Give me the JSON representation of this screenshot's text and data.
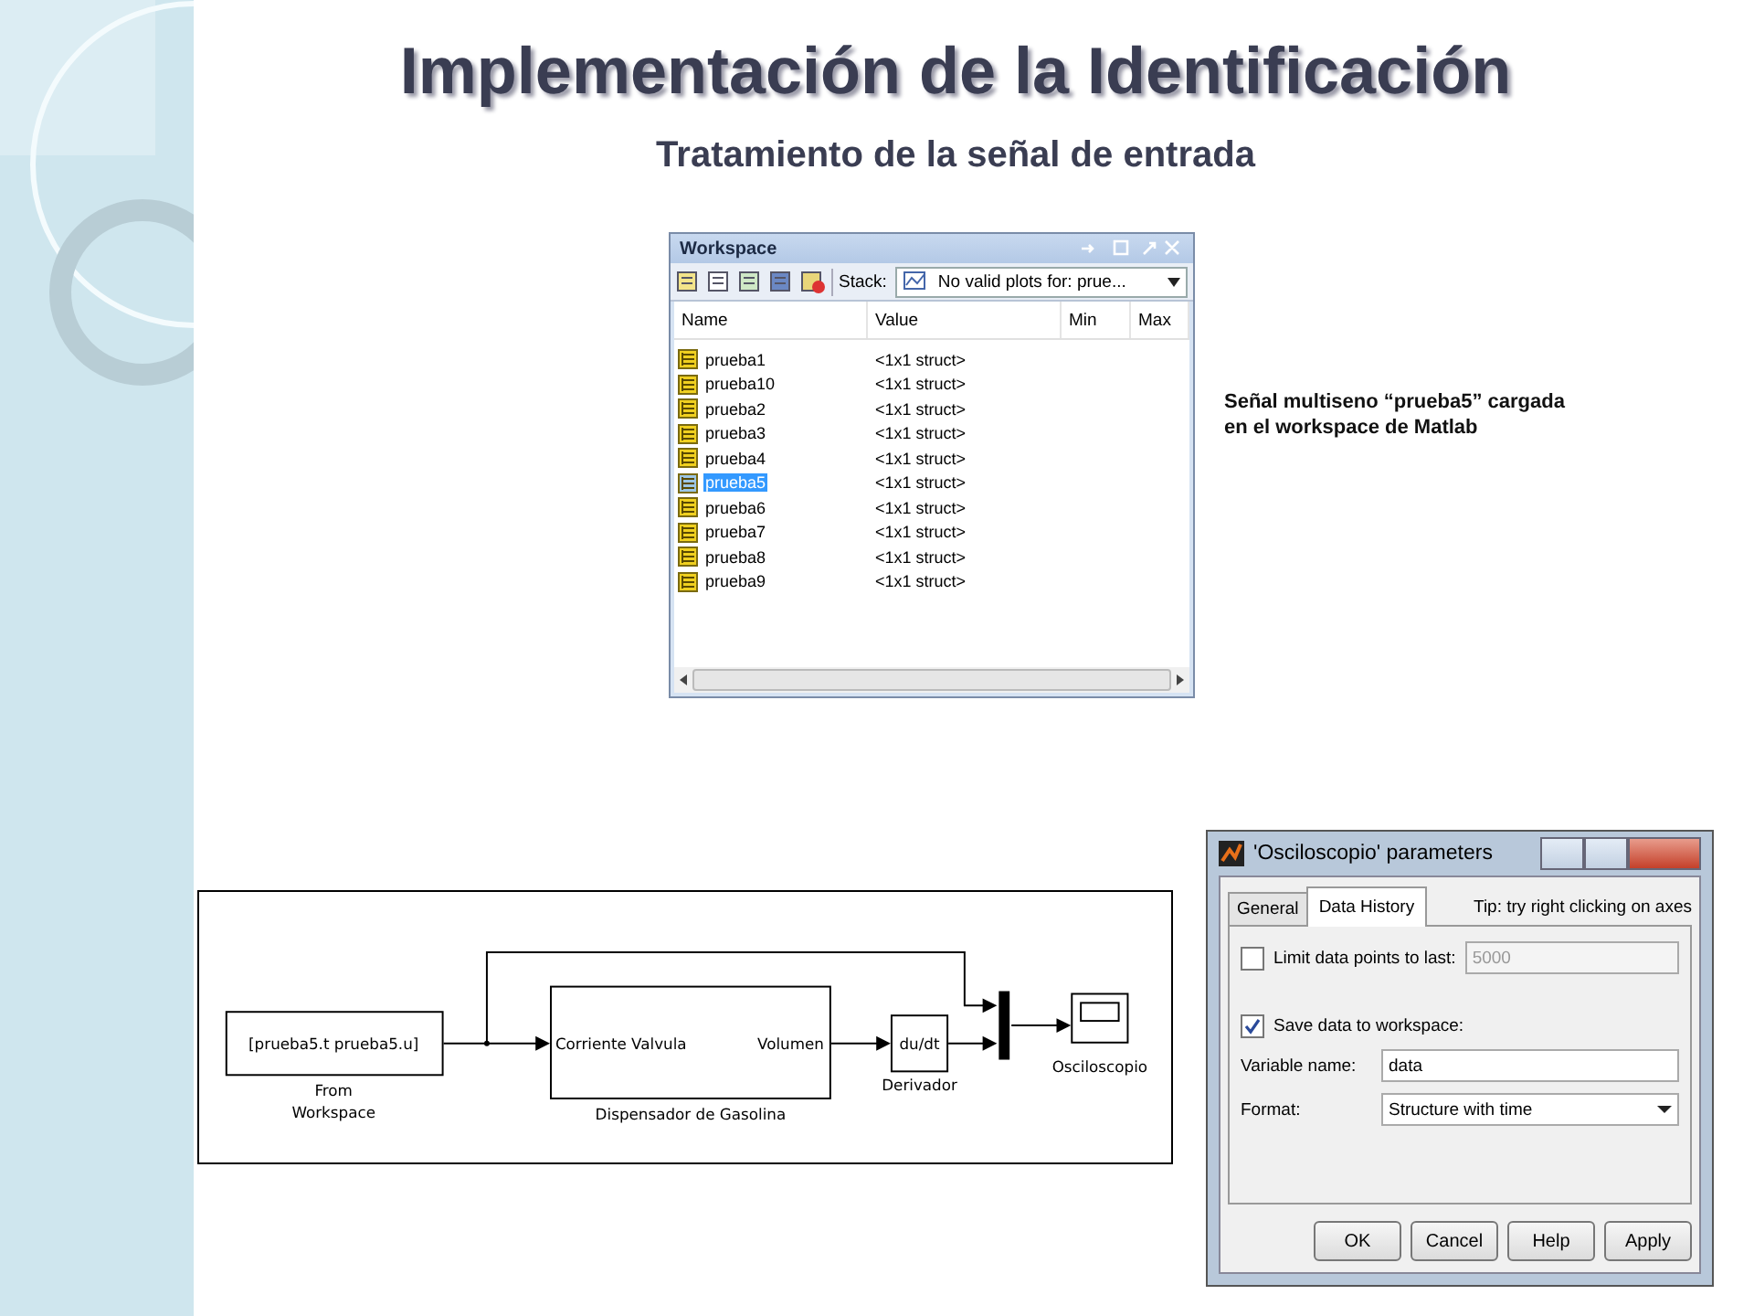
{
  "slide": {
    "title": "Implementación de la Identificación",
    "subtitle": "Tratamiento de la señal de entrada",
    "caption_lines": [
      "Señal multiseno “prueba5” cargada",
      "en el workspace de Matlab"
    ]
  },
  "workspace": {
    "title": "Workspace",
    "stack_label": "Stack:",
    "plots_dropdown": "No valid plots for: prue...",
    "columns": [
      "Name",
      "Value",
      "Min",
      "Max"
    ],
    "rows": [
      {
        "name": "prueba1",
        "value": "<1x1 struct>",
        "selected": false
      },
      {
        "name": "prueba10",
        "value": "<1x1 struct>",
        "selected": false
      },
      {
        "name": "prueba2",
        "value": "<1x1 struct>",
        "selected": false
      },
      {
        "name": "prueba3",
        "value": "<1x1 struct>",
        "selected": false
      },
      {
        "name": "prueba4",
        "value": "<1x1 struct>",
        "selected": false
      },
      {
        "name": "prueba5",
        "value": "<1x1 struct>",
        "selected": true
      },
      {
        "name": "prueba6",
        "value": "<1x1 struct>",
        "selected": false
      },
      {
        "name": "prueba7",
        "value": "<1x1 struct>",
        "selected": false
      },
      {
        "name": "prueba8",
        "value": "<1x1 struct>",
        "selected": false
      },
      {
        "name": "prueba9",
        "value": "<1x1 struct>",
        "selected": false
      }
    ]
  },
  "diagram": {
    "source_block": "[prueba5.t prueba5.u]",
    "source_label": [
      "From",
      "Workspace"
    ],
    "subsystem_input": "Corriente Valvula",
    "subsystem_output": "Volumen",
    "subsystem_label": "Dispensador de Gasolina",
    "derivative_block": "du/dt",
    "derivative_label": "Derivador",
    "scope_label": "Osciloscopio"
  },
  "dialog": {
    "title": "'Osciloscopio' parameters",
    "tabs": [
      {
        "label": "General",
        "selected": false
      },
      {
        "label": "Data History",
        "selected": true
      }
    ],
    "tip": "Tip: try right clicking on axes",
    "limit": {
      "label": "Limit data points to last:",
      "checked": false,
      "value": "5000",
      "disabled": true
    },
    "save": {
      "label": "Save data to workspace:",
      "checked": true
    },
    "variable_name": {
      "label": "Variable name:",
      "value": "data"
    },
    "format": {
      "label": "Format:",
      "value": "Structure with time"
    },
    "buttons": [
      "OK",
      "Cancel",
      "Help",
      "Apply"
    ]
  }
}
